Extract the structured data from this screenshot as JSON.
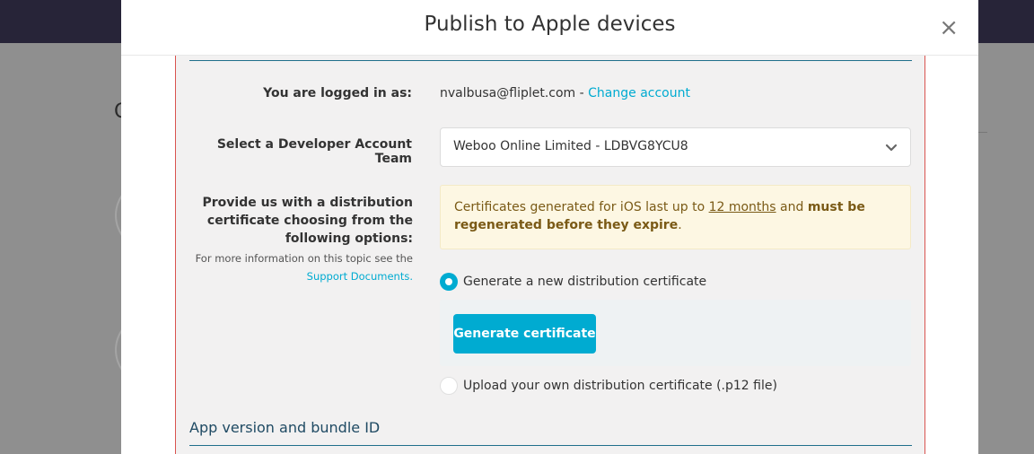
{
  "background": {
    "partial_heading_letter": "C"
  },
  "modal": {
    "title": "Publish to Apple devices",
    "close_icon": "close-icon"
  },
  "account": {
    "label": "You are logged in as:",
    "email": "nvalbusa@fliplet.com",
    "separator": " - ",
    "change_link": "Change account"
  },
  "team": {
    "label": "Select a Developer Account Team",
    "selected": "Weboo Online Limited - LDBVG8YCU8"
  },
  "certificate": {
    "label": "Provide us with a distribution certificate choosing from the following options:",
    "help_text": "For more information on this topic see the",
    "help_link": "Support Documents.",
    "alert": {
      "part1": "Certificates generated for iOS last up to ",
      "underline": "12 months",
      "part2": " and ",
      "bold": "must be regenerated before they expire",
      "end": "."
    },
    "option_generate": "Generate a new distribution certificate",
    "generate_button": "Generate certificate",
    "option_upload": "Upload your own distribution certificate (.p12 file)"
  },
  "next_section": {
    "title": "App version and bundle ID"
  },
  "colors": {
    "accent": "#00abd1",
    "alert_bg": "#fdf7e3",
    "alert_text": "#7a5a16",
    "error_border": "#d9534f",
    "topbar": "#272438"
  }
}
